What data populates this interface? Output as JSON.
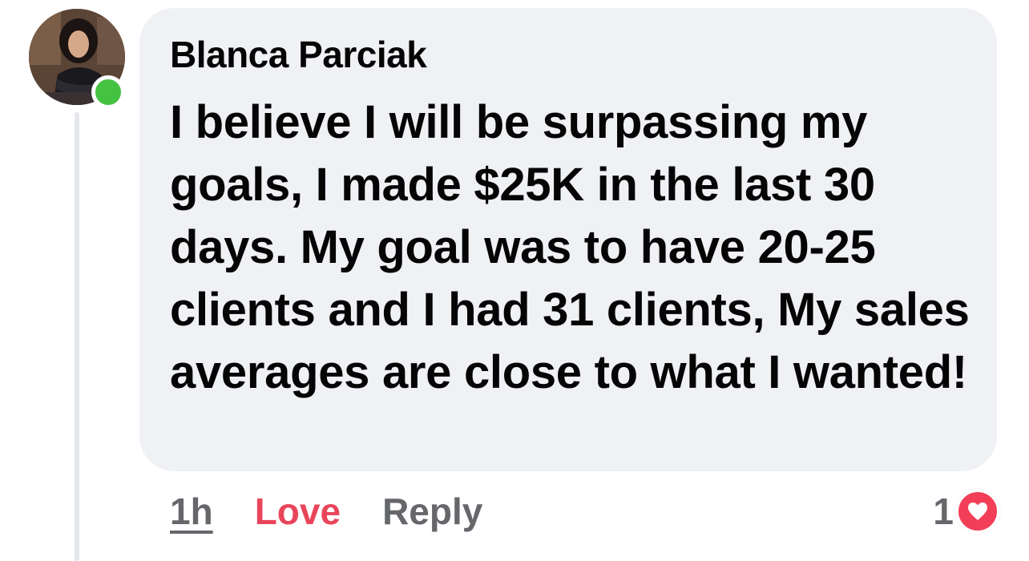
{
  "comment": {
    "author": "Blanca Parciak",
    "text": "I believe I will be surpassing my goals, I made $25K in the last 30 days. My goal was to have 20-25 clients and I had 31 clients, My sales averages are close to what I wanted!",
    "timestamp": "1h",
    "reaction_label": "Love",
    "reply_label": "Reply",
    "reaction_count": "1",
    "reaction_icon": "heart-icon",
    "online": true
  },
  "colors": {
    "bubble": "#f0f1f5",
    "text": "#050505",
    "muted": "#65676b",
    "love": "#e9455a",
    "heart_badge": "#f33e58",
    "online_dot": "#44c241"
  }
}
